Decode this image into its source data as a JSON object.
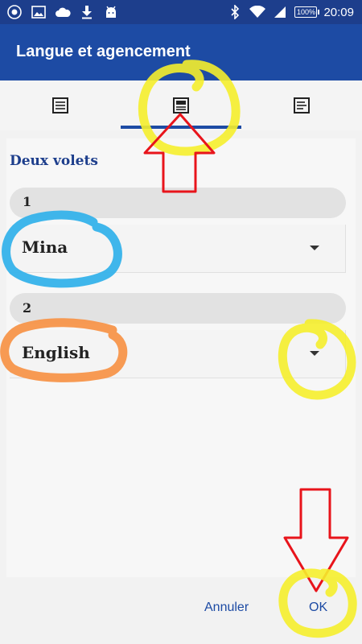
{
  "status_bar": {
    "battery": "100%",
    "time": "20:09",
    "icons_left": [
      "app-icon",
      "image-icon",
      "cloud-icon",
      "download-icon",
      "android-icon"
    ],
    "icons_right": [
      "bluetooth-icon",
      "wifi-icon",
      "signal-icon",
      "battery-icon"
    ]
  },
  "app_bar": {
    "title": "Langue et agencement",
    "color": "#1d4ba4"
  },
  "tabs": [
    {
      "icon": "single-pane-icon",
      "selected": false
    },
    {
      "icon": "two-pane-icon",
      "selected": true
    },
    {
      "icon": "list-pane-icon",
      "selected": false
    }
  ],
  "content": {
    "section_title": "Deux volets",
    "pane1": {
      "label": "1",
      "value": "Mina"
    },
    "pane2": {
      "label": "2",
      "value": "English"
    }
  },
  "buttons": {
    "cancel": "Annuler",
    "ok": "OK"
  },
  "annotation_colors": {
    "yellow": "#f5ee2c",
    "red": "#e8141b",
    "blue": "#35b2ea",
    "orange": "#f7954a"
  }
}
